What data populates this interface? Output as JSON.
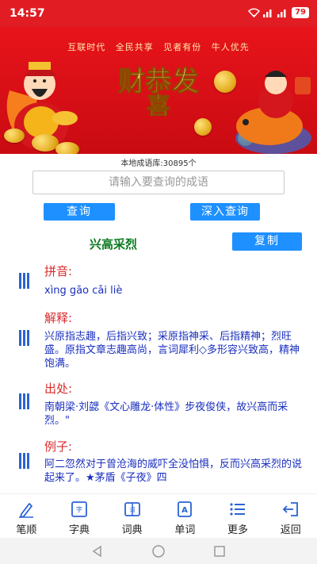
{
  "status": {
    "time": "14:57",
    "battery": "79"
  },
  "banner": {
    "slogans": [
      "互联时代",
      "全民共享",
      "见者有份",
      "牛人优先"
    ],
    "big_text": "恭喜发财"
  },
  "count_text": "本地成语库:30895个",
  "search": {
    "placeholder": "请输入要查询的成语"
  },
  "buttons": {
    "query": "查询",
    "deep_query": "深入查询",
    "copy": "复制"
  },
  "idiom": "兴高采烈",
  "sections": [
    {
      "title": "拼音:",
      "text": "xìng gāo cǎi liè"
    },
    {
      "title": "解释:",
      "text": "兴原指志趣，后指兴致；采原指神采、后指精神；烈旺盛。原指文章志趣高尚，言词犀利◇多形容兴致高，精神饱满。"
    },
    {
      "title": "出处:",
      "text": "南朝梁·刘勰《文心雕龙·体性》步夜俊侠，故兴高而采烈。\""
    },
    {
      "title": "例子:",
      "text": "阿二忽然对于曾沧海的威吓全没怕惧，反而兴高采烈的说起来了。★茅盾《子夜》四"
    }
  ],
  "nav": [
    {
      "label": "笔顺",
      "icon": "pen-icon"
    },
    {
      "label": "字典",
      "icon": "dictionary-icon"
    },
    {
      "label": "词典",
      "icon": "word-dictionary-icon"
    },
    {
      "label": "单词",
      "icon": "word-card-icon"
    },
    {
      "label": "更多",
      "icon": "list-icon"
    },
    {
      "label": "返回",
      "icon": "exit-icon"
    }
  ],
  "colors": {
    "header_red": "#e11d23",
    "button_blue": "#1e90ff",
    "idiom_green": "#0b7a1f",
    "title_red": "#d92b2b",
    "text_blue": "#1a2fbf"
  }
}
